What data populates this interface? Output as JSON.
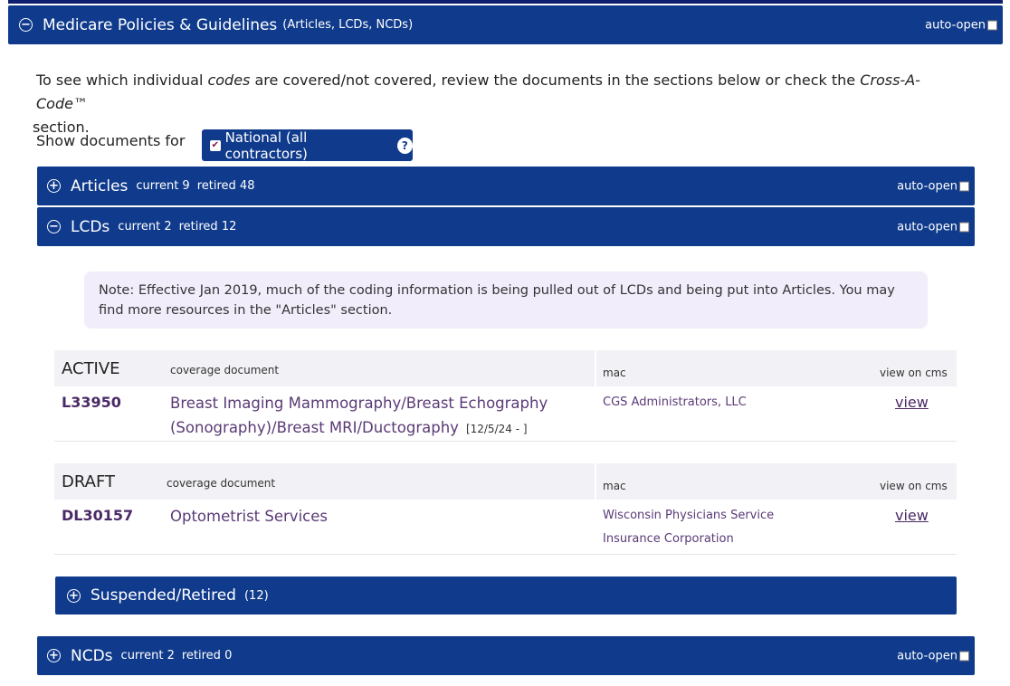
{
  "main": {
    "title": "Medicare Policies & Guidelines",
    "subtitle": "(Articles, LCDs, NCDs)",
    "auto_open": "auto-open"
  },
  "intro": {
    "p1": "To see which individual ",
    "p1_em": "codes",
    "p2": " are covered/not covered, review the documents in the sections below or check the ",
    "p2_em": "Cross-A-Code™",
    "p3": " section."
  },
  "filter": {
    "label": "Show documents for",
    "option": "National (all contractors)",
    "help": "?"
  },
  "articles": {
    "title": "Articles",
    "current": "current 9",
    "retired": "retired 48",
    "auto_open": "auto-open"
  },
  "lcds": {
    "title": "LCDs",
    "current": "current 2",
    "retired": "retired 12",
    "auto_open": "auto-open"
  },
  "note": "Note:  Effective Jan 2019, much of the coding information is being pulled out of LCDs and being put into Articles. You may find more resources in the \"Articles\" section.",
  "active": {
    "status": "ACTIVE",
    "col_doc": "coverage document",
    "col_mac": "mac",
    "col_view": "view on cms",
    "id": "L33950",
    "doc": "Breast Imaging Mammography/Breast Echography (Sonography)/Breast MRI/Ductography",
    "date": "[12/5/24 - ]",
    "mac": "CGS Administrators, LLC",
    "view": "view"
  },
  "draft": {
    "status": "DRAFT",
    "col_doc": "coverage document",
    "col_mac": "mac",
    "col_view": "view on cms",
    "id": "DL30157",
    "doc": "Optometrist Services",
    "mac": "Wisconsin Physicians Service Insurance Corporation",
    "view": "view"
  },
  "suspended": {
    "title": "Suspended/Retired",
    "count": "(12)"
  },
  "ncds": {
    "title": "NCDs",
    "current": "current 2",
    "retired": "retired 0",
    "auto_open": "auto-open"
  },
  "colors": {
    "bar": "#103b8c",
    "note_bg": "#f1edfb",
    "link": "#4a2a66"
  }
}
